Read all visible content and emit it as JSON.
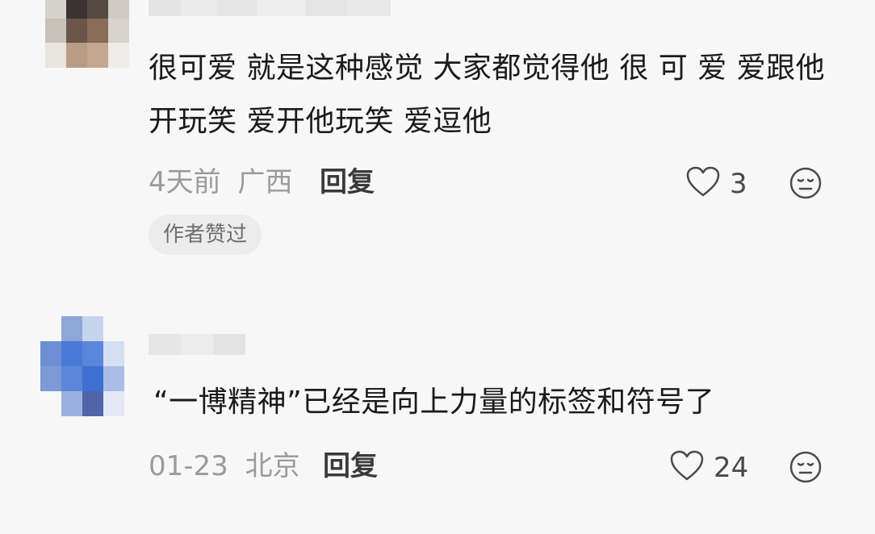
{
  "comments": [
    {
      "text": "很可爱 就是这种感觉 大家都觉得他 很 可 爱 爱跟他开玩笑 爱开他玩笑 爱逗他",
      "time": "4天前",
      "location": "广西",
      "reply_label": "回复",
      "likes": "3",
      "badge": "作者赞过",
      "avatar_desc": "pixelated-user-avatar"
    },
    {
      "text": "“一博精神”已经是向上力量的标签和符号了",
      "time": "01-23",
      "location": "北京",
      "reply_label": "回复",
      "likes": "24",
      "avatar_desc": "pixelated-user-avatar"
    }
  ],
  "icons": {
    "like": "heart-outline-icon",
    "emoji": "neutral-face-icon"
  },
  "colors": {
    "background": "#f7f7f7",
    "text": "#1a1a1a",
    "meta": "#9b9b9b",
    "reply": "#3a3a3a",
    "badge_bg": "#ececec"
  }
}
